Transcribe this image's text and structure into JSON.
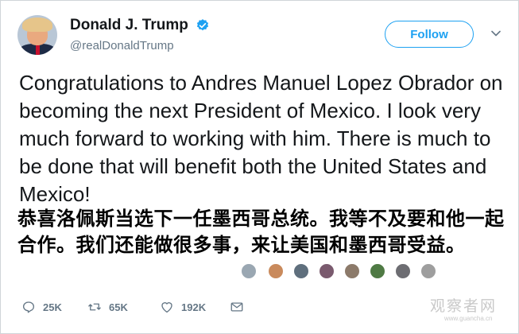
{
  "user": {
    "name": "Donald J. Trump",
    "handle": "@realDonaldTrump",
    "verified": true
  },
  "follow_button": {
    "label": "Follow"
  },
  "tweet": {
    "text": "Congratulations to Andres Manuel Lopez Obrador on becoming the next President of Mexico. I look very much forward to working with him. There is much to be done that will benefit both the United States and Mexico!"
  },
  "overlay_caption": {
    "text": "恭喜洛佩斯当选下一任墨西哥总统。我等不及要和他一起合作。我们还能做很多事，来让美国和墨西哥受益。"
  },
  "actions": {
    "replies": "25K",
    "retweets": "65K",
    "likes": "192K"
  },
  "watermark": {
    "name": "观察者网",
    "url": "www.guancha.cn"
  },
  "colors": {
    "accent": "#1da1f2",
    "text": "#14171a",
    "secondary": "#657786"
  }
}
